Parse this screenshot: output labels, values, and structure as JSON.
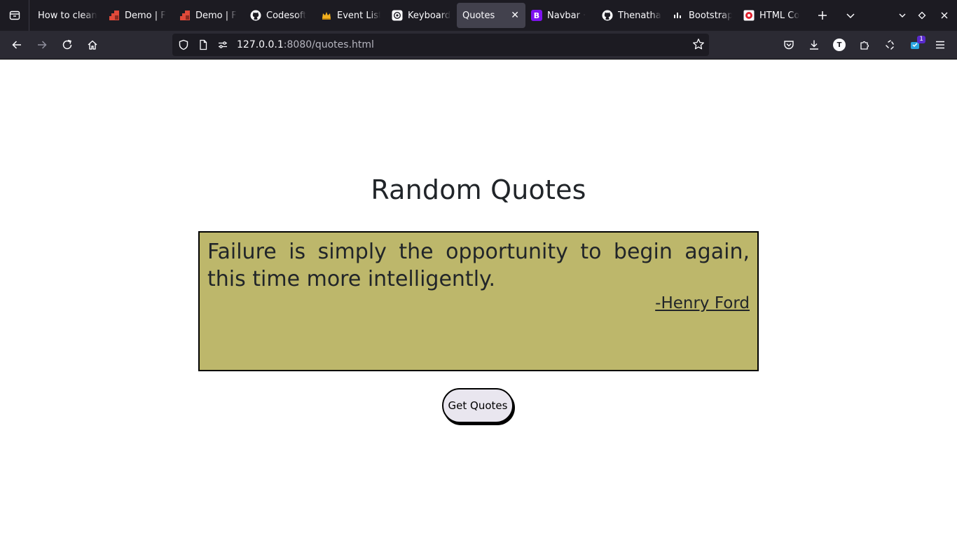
{
  "tabs": [
    {
      "title": "How to clean",
      "favicon": "none-icon",
      "active": false
    },
    {
      "title": "Demo | F",
      "favicon": "demo-icon",
      "active": false
    },
    {
      "title": "Demo | F",
      "favicon": "demo-icon",
      "active": false
    },
    {
      "title": "Codesoft",
      "favicon": "github-icon",
      "active": false
    },
    {
      "title": "Event List",
      "favicon": "crown-icon",
      "active": false
    },
    {
      "title": "Keyboard",
      "favicon": "openai-icon",
      "active": false
    },
    {
      "title": "Quotes",
      "favicon": "none-icon",
      "active": true
    },
    {
      "title": "Navbar ·",
      "favicon": "bootstrap-icon",
      "active": false
    },
    {
      "title": "Thenatha",
      "favicon": "github-icon",
      "active": false
    },
    {
      "title": "Bootstrap",
      "favicon": "bars-icon",
      "active": false
    },
    {
      "title": "HTML Co",
      "favicon": "html-icon",
      "active": false
    }
  ],
  "address": {
    "host": "127.0.0.1",
    "path": ":8080/quotes.html"
  },
  "extensions_badge": "1",
  "profile_initial": "T",
  "page": {
    "heading": "Random Quotes",
    "quote": "Failure is simply the opportunity to begin again, this time more intelligently.",
    "author": "-Henry Ford",
    "button_label": "Get Quotes"
  },
  "colors": {
    "quote_background": "#bdb76b",
    "tabbar": "#1c1b22",
    "toolbar": "#2b2a33",
    "active_tab": "#42414d"
  }
}
